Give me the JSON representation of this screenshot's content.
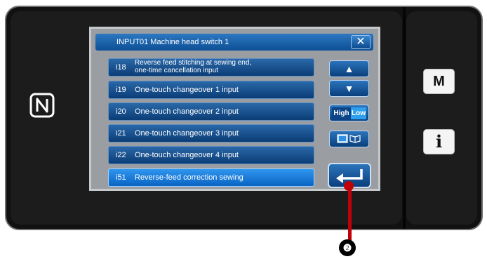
{
  "dialog": {
    "title": "INPUT01  Machine head switch 1",
    "close_label": "✕"
  },
  "items": [
    {
      "code": "i18",
      "line1": "Reverse feed stitching at sewing end,",
      "line2": "one-time cancellation input"
    },
    {
      "code": "i19",
      "label": "One-touch changeover 1 input"
    },
    {
      "code": "i20",
      "label": "One-touch changeover 2 input"
    },
    {
      "code": "i21",
      "label": "One-touch changeover 3 input"
    },
    {
      "code": "i22",
      "label": "One-touch changeover 4 input"
    },
    {
      "code": "i51",
      "label": "Reverse-feed correction sewing",
      "selected": true
    }
  ],
  "controls": {
    "up_glyph": "▲",
    "down_glyph": "▼",
    "high_label": "High",
    "low_label": "Low"
  },
  "side_panel": {
    "m_label": "M",
    "i_label": "i"
  },
  "callout_label": "❷",
  "colors": {
    "item_blue": "#0b3d76",
    "selected_blue": "#1d84e0",
    "callout_red": "#c00008"
  }
}
